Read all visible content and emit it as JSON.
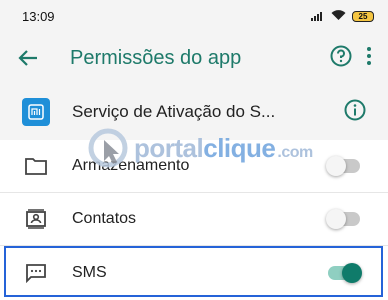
{
  "status_bar": {
    "time": "13:09",
    "battery": "25"
  },
  "app_bar": {
    "title": "Permissões do app"
  },
  "app_header": {
    "name": "Serviço de Ativação do S..."
  },
  "permissions": [
    {
      "label": "Armazenamento",
      "enabled": false
    },
    {
      "label": "Contatos",
      "enabled": false
    },
    {
      "label": "SMS",
      "enabled": true
    }
  ],
  "watermark": {
    "part1": "portal",
    "part2": "clique",
    "part3": ".com"
  },
  "colors": {
    "accent": "#1e7a6a",
    "toggle_on": "#0f7b6a",
    "highlight": "#2563d8",
    "app_logo": "#1f8fd8"
  }
}
